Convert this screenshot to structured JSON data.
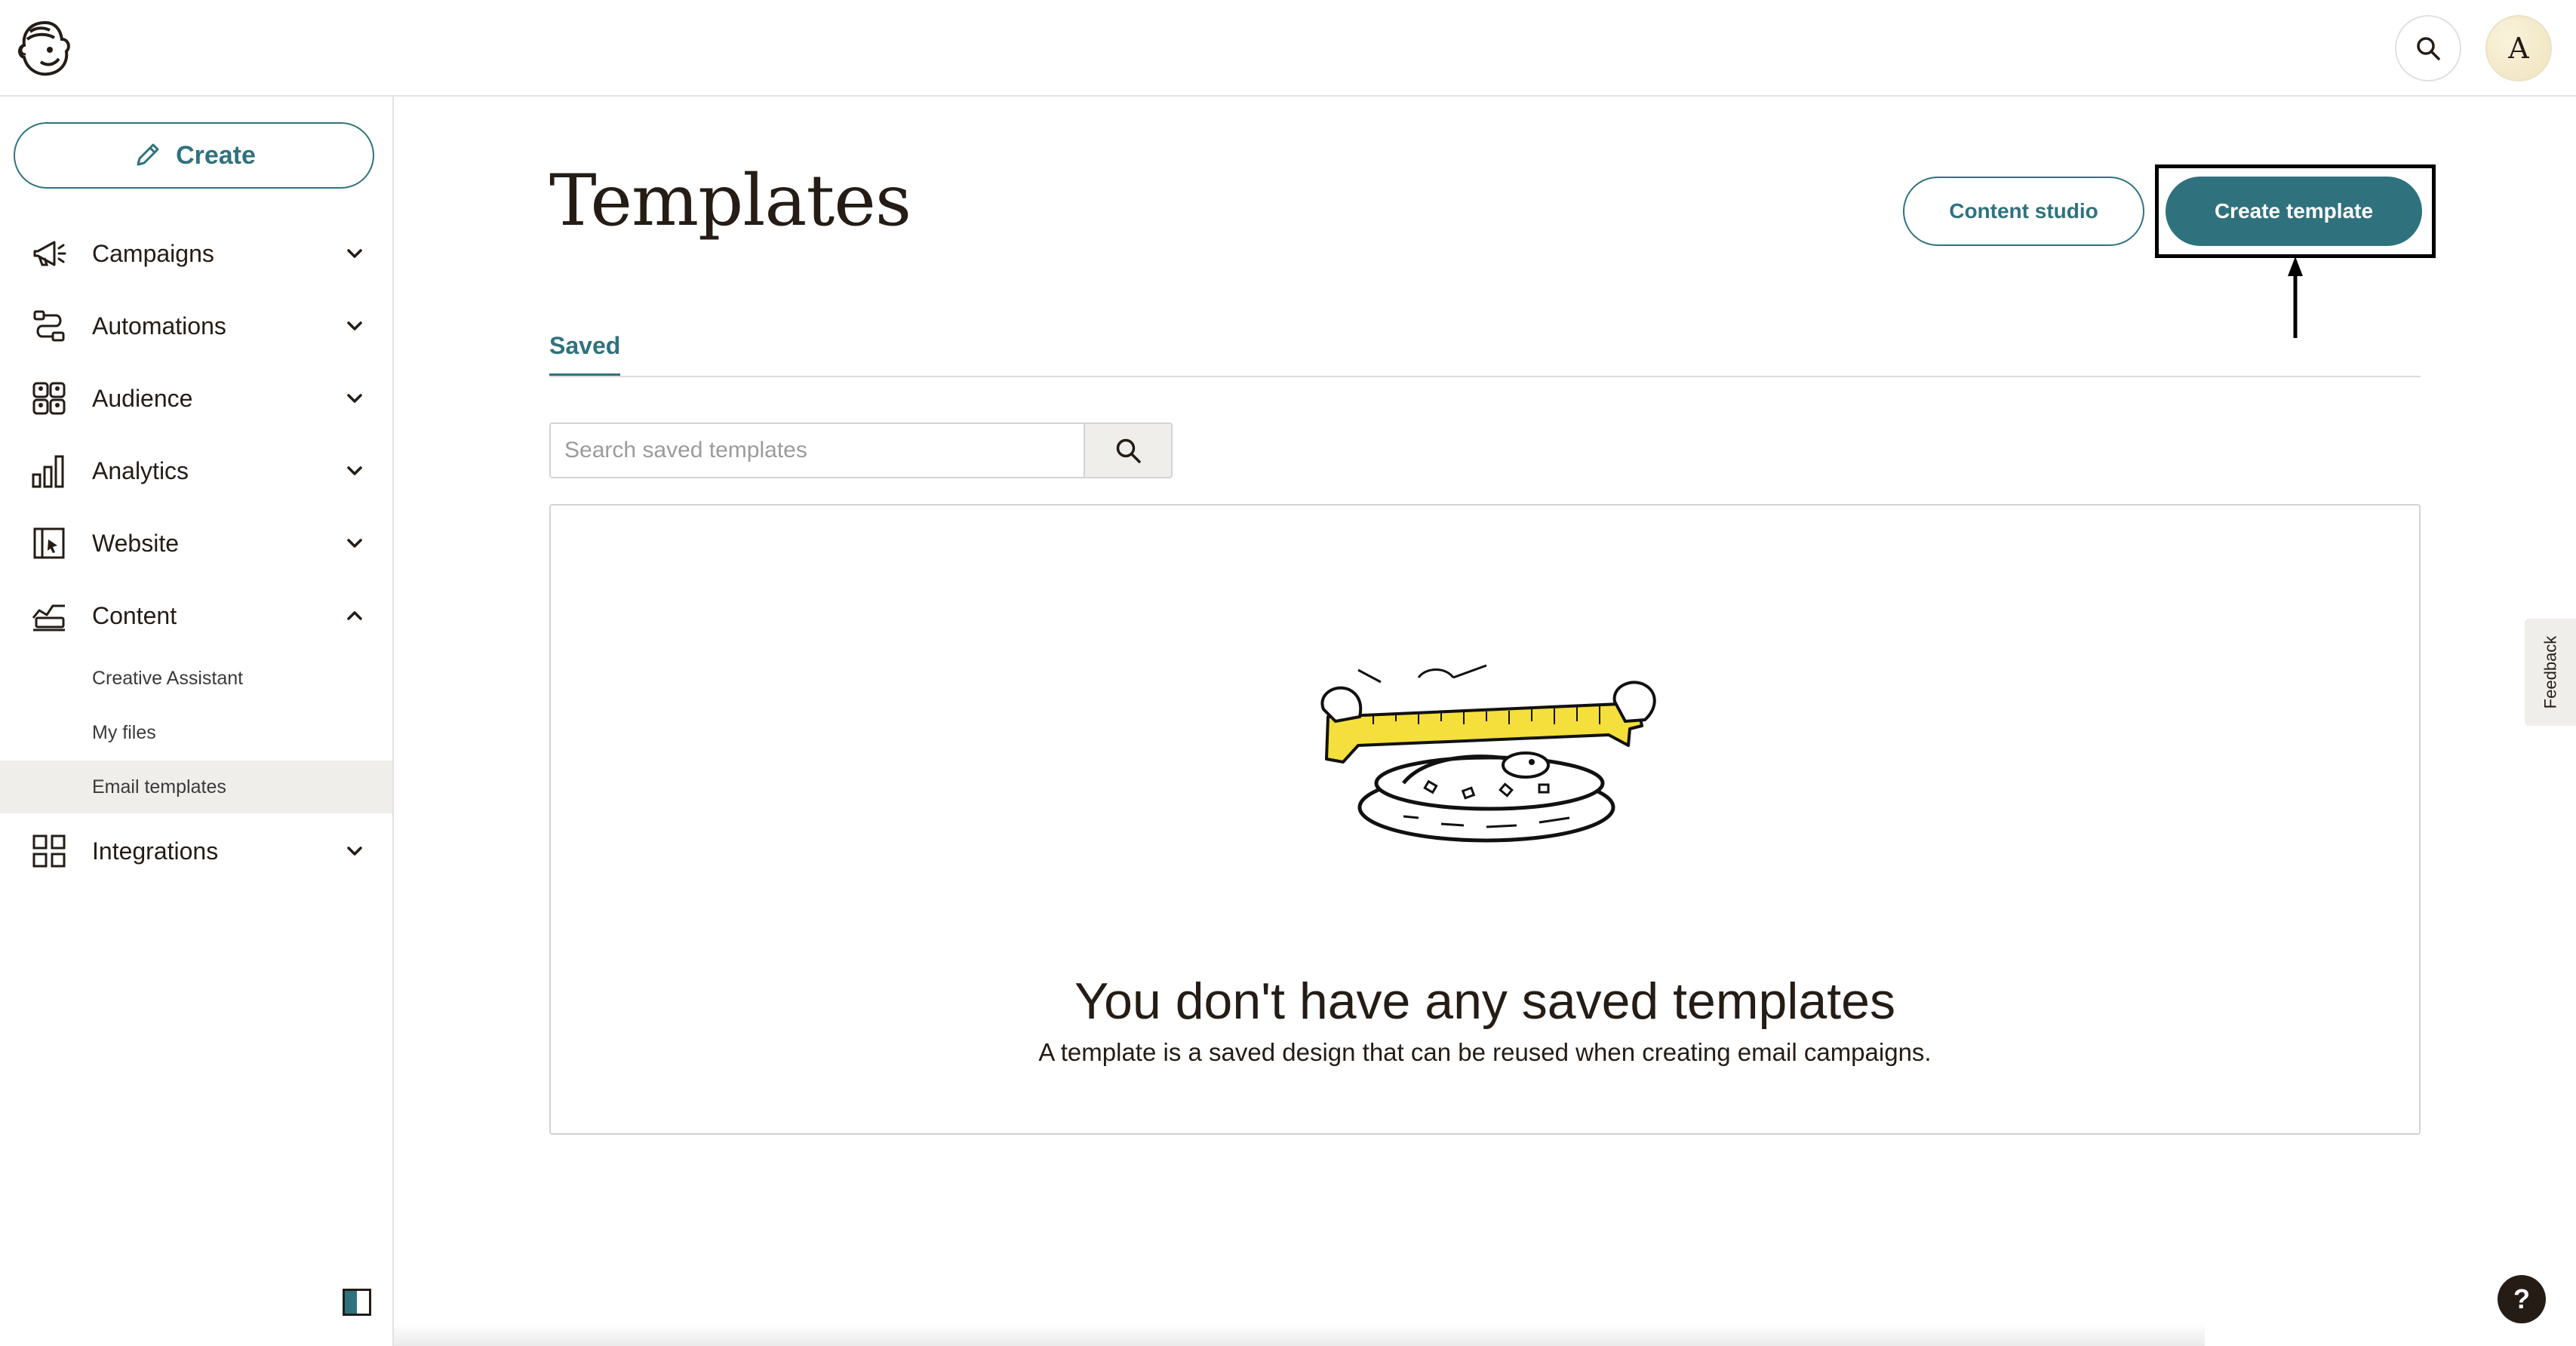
{
  "header": {
    "logo_icon": "freddie-logo",
    "search_icon": "search-icon",
    "avatar_initial": "A"
  },
  "sidebar": {
    "create_label": "Create",
    "items": [
      {
        "label": "Campaigns",
        "icon": "megaphone-icon",
        "expanded": false
      },
      {
        "label": "Automations",
        "icon": "automation-flow-icon",
        "expanded": false
      },
      {
        "label": "Audience",
        "icon": "audience-icon",
        "expanded": false
      },
      {
        "label": "Analytics",
        "icon": "bar-chart-icon",
        "expanded": false
      },
      {
        "label": "Website",
        "icon": "website-icon",
        "expanded": false
      },
      {
        "label": "Content",
        "icon": "content-icon",
        "expanded": true
      },
      {
        "label": "Integrations",
        "icon": "grid-icon",
        "expanded": false
      }
    ],
    "content_subitems": [
      {
        "label": "Creative Assistant",
        "active": false
      },
      {
        "label": "My files",
        "active": false
      },
      {
        "label": "Email templates",
        "active": true
      }
    ]
  },
  "main": {
    "title": "Templates",
    "content_studio_label": "Content studio",
    "create_template_label": "Create template",
    "tabs": [
      {
        "label": "Saved",
        "active": true
      }
    ],
    "search": {
      "placeholder": "Search saved templates",
      "value": ""
    },
    "empty_state": {
      "title": "You don't have any saved templates",
      "description": "A template is a saved design that can be reused when creating email campaigns."
    }
  },
  "feedback_label": "Feedback",
  "help_label": "?",
  "colors": {
    "accent": "#2f727e",
    "text": "#241c15",
    "active_bg": "#efeeea",
    "illustration_yellow": "#f5df3c"
  }
}
